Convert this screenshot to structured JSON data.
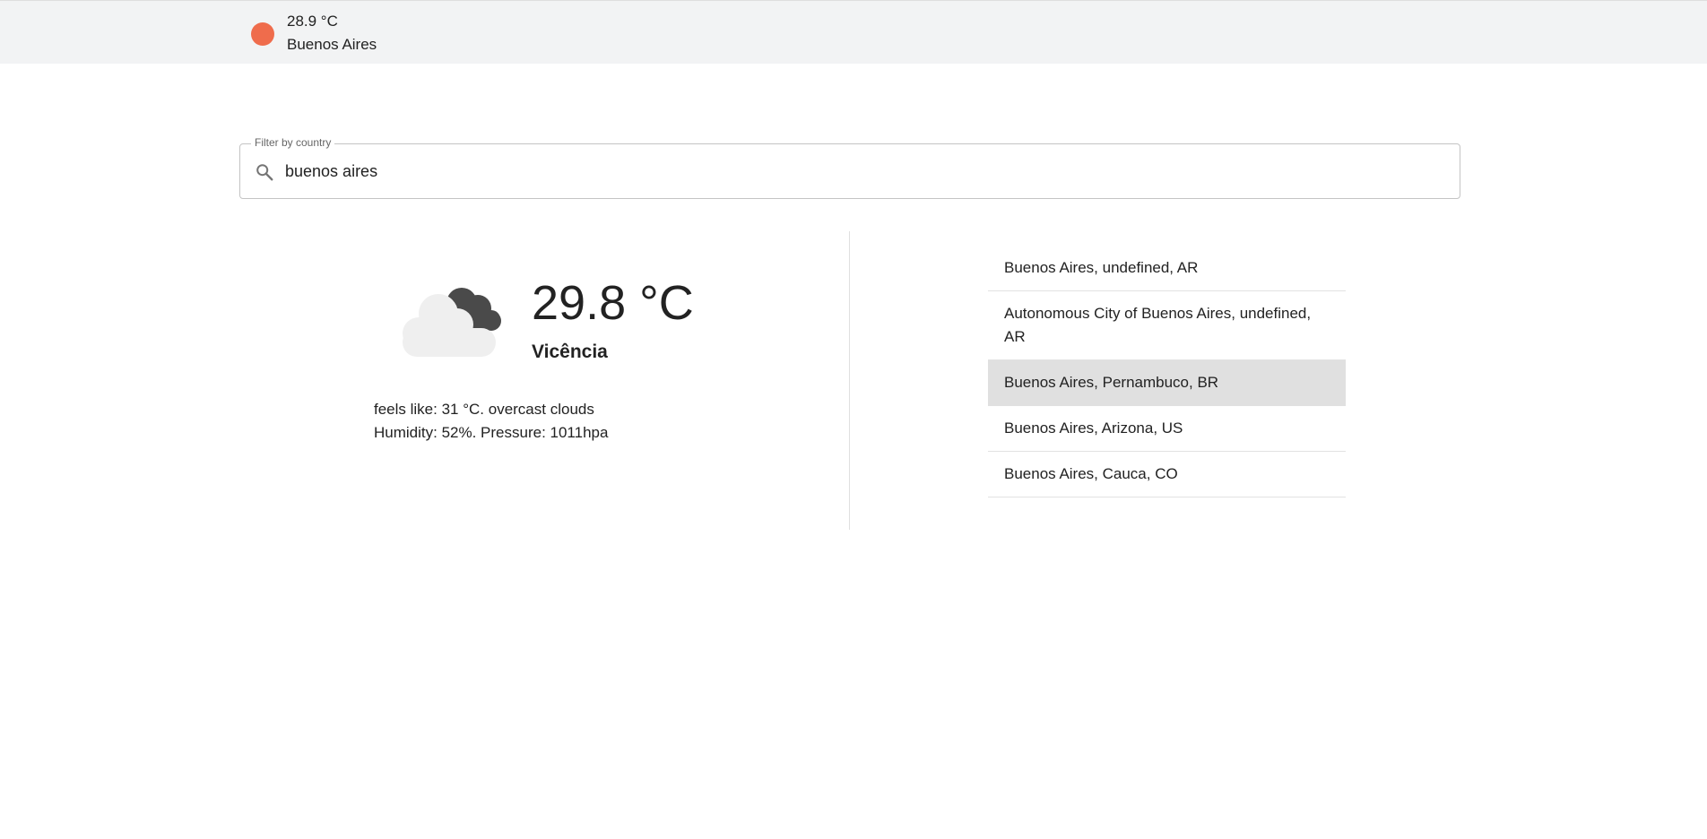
{
  "header": {
    "temperature": "28.9 °C",
    "city": "Buenos Aires",
    "indicator_color": "#ef6c4c"
  },
  "filter": {
    "label": "Filter by country",
    "value": "buenos aires",
    "icon": "search-icon"
  },
  "weather": {
    "icon": "cloud-icon",
    "temperature": "29.8 °C",
    "city": "Vicência",
    "feels_line": "feels like: 31 °C. overcast clouds",
    "stats_line": "Humidity: 52%. Pressure: 1011hpa"
  },
  "results": [
    {
      "label": "Buenos Aires, undefined, AR"
    },
    {
      "label": "Autonomous City of Buenos Aires, undefined, AR"
    },
    {
      "label": "Buenos Aires, Pernambuco, BR",
      "active": true
    },
    {
      "label": "Buenos Aires, Arizona, US"
    },
    {
      "label": "Buenos Aires, Cauca, CO"
    }
  ]
}
